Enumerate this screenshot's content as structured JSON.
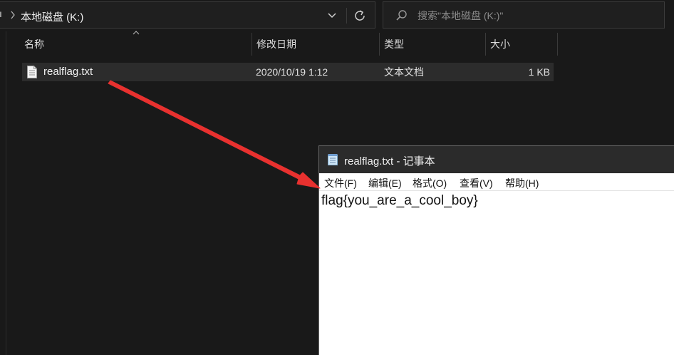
{
  "address": {
    "left_glyph": "ı",
    "path": "本地磁盘 (K:)"
  },
  "search": {
    "placeholder": "搜索\"本地磁盘 (K:)\""
  },
  "columns": {
    "name": "名称",
    "date": "修改日期",
    "type": "类型",
    "size": "大小"
  },
  "files": [
    {
      "name": "realflag.txt",
      "modified": "2020/10/19 1:12",
      "type": "文本文档",
      "size": "1 KB"
    }
  ],
  "notepad": {
    "title": "realflag.txt - 记事本",
    "menu": [
      "文件(F)",
      "编辑(E)",
      "格式(O)",
      "查看(V)",
      "帮助(H)"
    ],
    "content": "flag{you_are_a_cool_boy}"
  },
  "colors": {
    "explorer_bg": "#191919",
    "selected_row": "#2c2c2c",
    "annotation_arrow": "#e8312f"
  }
}
